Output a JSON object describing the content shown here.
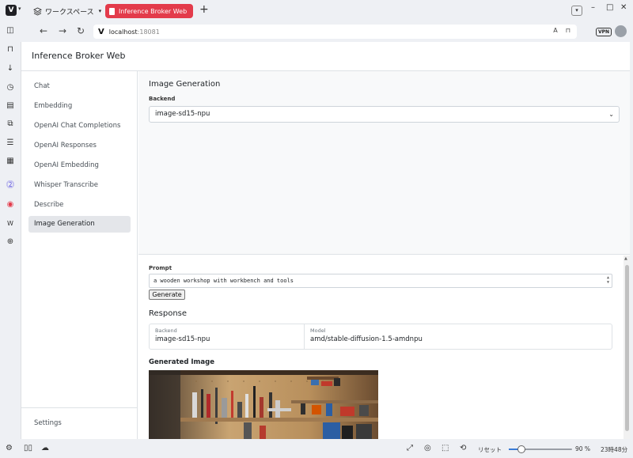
{
  "browser": {
    "workspace_label": "ワークスペース",
    "tab_title": "Inference Broker Web",
    "url_host": "localhost",
    "url_port": ":18081",
    "vpn_label": "VPN",
    "reset_label": "リセット",
    "zoom_text": "90 %",
    "zoom_level": 0.9,
    "clock": "23時48分",
    "accent_color": "#e33b4b"
  },
  "app": {
    "title": "Inference Broker Web"
  },
  "sidebar": {
    "items": [
      {
        "label": "Chat"
      },
      {
        "label": "Embedding"
      },
      {
        "label": "OpenAI Chat Completions"
      },
      {
        "label": "OpenAI Responses"
      },
      {
        "label": "OpenAI Embedding"
      },
      {
        "label": "Whisper Transcribe"
      },
      {
        "label": "Describe"
      },
      {
        "label": "Image Generation"
      }
    ],
    "active": "Image Generation",
    "settings_label": "Settings"
  },
  "main": {
    "section_title": "Image Generation",
    "backend_label": "Backend",
    "backend_value": "image-sd15-npu",
    "prompt_label": "Prompt",
    "prompt_value": "a wooden workshop with workbench and tools",
    "generate_label": "Generate",
    "response_title": "Response",
    "response": {
      "backend_key": "Backend",
      "backend_value": "image-sd15-npu",
      "model_key": "Model",
      "model_value": "amd/stable-diffusion-1.5-amdnpu"
    },
    "generated_image_title": "Generated Image"
  }
}
